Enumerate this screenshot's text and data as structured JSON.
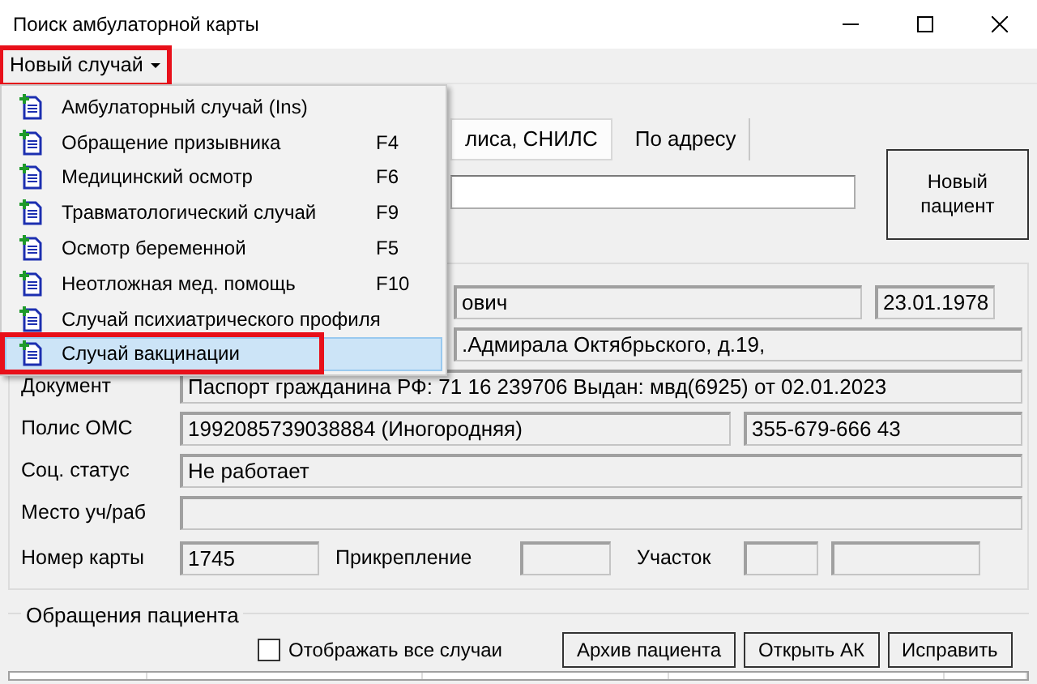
{
  "window": {
    "title": "Поиск амбулаторной карты"
  },
  "menu_button": {
    "label": "Новый случай",
    "highlighted": true
  },
  "menu": [
    {
      "label": "Амбулаторный случай (Ins)",
      "selected": false,
      "highlighted": false
    },
    {
      "label": "Обращение призывника",
      "shortcut": "F4",
      "selected": false,
      "highlighted": false
    },
    {
      "label": "Медицинский осмотр",
      "shortcut": "F6",
      "selected": false,
      "highlighted": false
    },
    {
      "label": "Травматологический случай",
      "shortcut": "F9",
      "selected": false,
      "highlighted": false
    },
    {
      "label": "Осмотр беременной",
      "shortcut": "F5",
      "selected": false,
      "highlighted": false
    },
    {
      "label": "Неотложная мед. помощь",
      "shortcut": "F10",
      "selected": false,
      "highlighted": false
    },
    {
      "label": "Случай психиатрического профиля",
      "selected": false,
      "highlighted": false
    },
    {
      "label": "Случай вакцинации",
      "selected": true,
      "highlighted": true
    }
  ],
  "search_tabs": [
    {
      "label": "лиса, СНИЛС",
      "selected": true
    },
    {
      "label": "По адресу",
      "selected": false
    }
  ],
  "new_patient_button": "Новый пациент",
  "patient": {
    "name_tail": "ович",
    "birth_date": "23.01.1978",
    "address_tail": ".Адмирала Октябрьского, д.19,",
    "document_label": "Документ",
    "document": "Паспорт гражданина РФ: 71 16 239706 Выдан: мвд(6925) от 02.01.2023",
    "policy_label": "Полис ОМС",
    "policy": "1992085739038884 (Иногородняя)",
    "snils": "355-679-666 43",
    "status_label": "Соц. статус",
    "status": "Не работает",
    "workplace_label": "Место уч/раб",
    "card_label": "Номер карты",
    "card_number": "1745",
    "attachment_label": "Прикрепление",
    "district_label": "Участок"
  },
  "cases": {
    "title": "Обращения пациента",
    "show_all": {
      "label": "Отображать все случаи",
      "checked": false
    },
    "buttons": [
      "Архив пациента",
      "Открыть АК",
      "Исправить"
    ]
  }
}
